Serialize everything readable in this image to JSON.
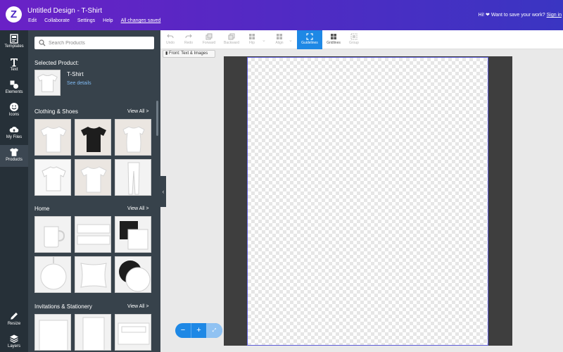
{
  "header": {
    "logo_letter": "Z",
    "title": "Untitled Design - T-Shirt",
    "menu": [
      "Edit",
      "Collaborate",
      "Settings",
      "Help"
    ],
    "save_status": "All changes saved",
    "prompt": "Hi! ❤ Want to save your work?",
    "sign_in": "Sign in"
  },
  "rail": {
    "items": [
      {
        "label": "Templates",
        "icon": "templates-icon"
      },
      {
        "label": "Text",
        "icon": "text-icon"
      },
      {
        "label": "Elements",
        "icon": "elements-icon"
      },
      {
        "label": "Icons",
        "icon": "icons-icon"
      },
      {
        "label": "My Files",
        "icon": "cloud-upload-icon"
      },
      {
        "label": "Products",
        "icon": "tshirt-icon"
      }
    ],
    "bottom_items": [
      {
        "label": "Resize",
        "icon": "pencil-icon"
      },
      {
        "label": "Layers",
        "icon": "layers-icon"
      }
    ],
    "active": "Products"
  },
  "panel": {
    "search_placeholder": "Search Products",
    "selected_label": "Selected Product:",
    "selected_name": "T-Shirt",
    "see_details": "See details",
    "sections": [
      {
        "title": "Clothing & Shoes",
        "view_all": "View All >"
      },
      {
        "title": "Home",
        "view_all": "View All >"
      },
      {
        "title": "Invitations & Stationery",
        "view_all": "View All >"
      }
    ],
    "collapse_glyph": "‹"
  },
  "toolbar": {
    "tools": [
      {
        "label": "Undo",
        "state": "disabled"
      },
      {
        "label": "Redo",
        "state": "disabled"
      },
      {
        "label": "Forward",
        "state": "disabled"
      },
      {
        "label": "Backward",
        "state": "disabled"
      },
      {
        "label": "Flip",
        "state": "disabled"
      },
      {
        "label": "Align",
        "state": "disabled"
      },
      {
        "label": "Guidelines",
        "state": "active"
      },
      {
        "label": "Gridlines",
        "state": "enabled"
      },
      {
        "label": "Group",
        "state": "disabled"
      }
    ],
    "front_tab": "Front: Text & Images"
  },
  "zoom": {
    "minus": "−",
    "plus": "+",
    "fit": "⤢"
  },
  "colors": {
    "header_gradient_start": "#6a21c6",
    "header_gradient_end": "#3a35c2",
    "accent": "#1e88e5",
    "panel": "#37424b",
    "rail": "#263038"
  }
}
